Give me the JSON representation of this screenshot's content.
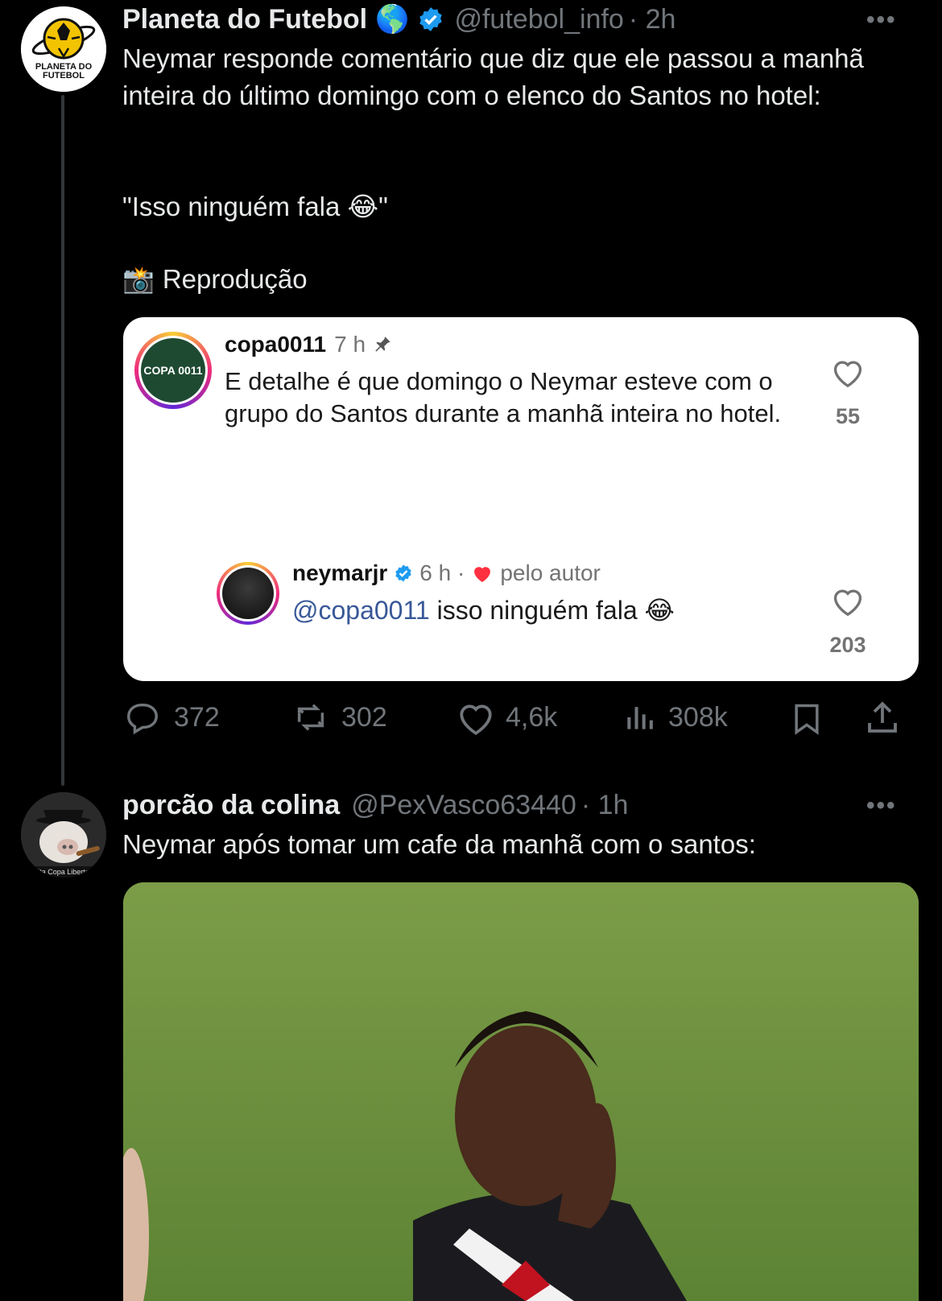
{
  "tweet1": {
    "display_name": "Planeta do Futebol",
    "handle": "@futebol_info",
    "time": "· 2h",
    "globe_emoji": "🌎",
    "avatar_text": "PLANETA DO FUTEBOL",
    "text_main": "Neymar responde comentário que diz que ele passou a manhã inteira do último domingo com o elenco do Santos no hotel:",
    "quote_line": "\"Isso ninguém fala 😂\"",
    "credit_emoji": "📸",
    "credit_text": "Reprodução",
    "embed": {
      "comment1": {
        "username": "copa0011",
        "time": "7 h",
        "avatar_text": "COPA 0011",
        "text": "E detalhe é que domingo o Neymar esteve com o grupo do Santos durante a manhã inteira no hotel.",
        "likes": "55"
      },
      "reply": {
        "username": "neymarjr",
        "time": "6 h ·",
        "liked_by": "pelo autor",
        "mention": "@copa0011",
        "text": " isso ninguém fala 😂",
        "likes": "203"
      }
    },
    "actions": {
      "replies": "372",
      "retweets": "302",
      "likes": "4,6k",
      "views": "308k"
    }
  },
  "tweet2": {
    "display_name": "porcão da colina",
    "handle": "@PexVasco63440",
    "time": "· 1h",
    "avatar_text": "ita Copa Liberta",
    "text": "Neymar após tomar um cafe da manhã com o santos:"
  },
  "colors": {
    "background": "#000000",
    "verified": "#1d9bf0",
    "muted": "#71767b",
    "ig_mention": "#385898",
    "heart_red": "#ff3040"
  }
}
